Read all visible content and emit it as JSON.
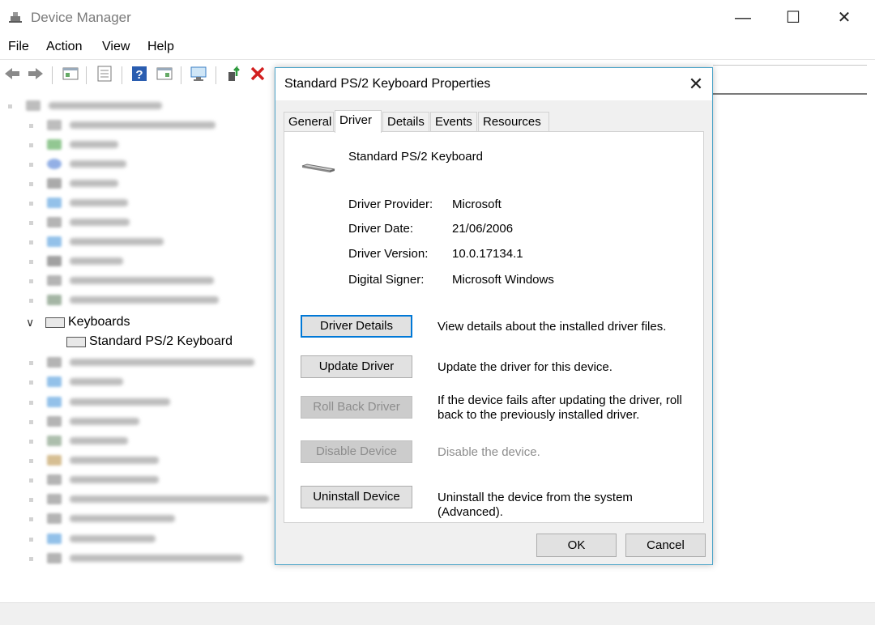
{
  "window": {
    "title": "Device Manager",
    "controls": {
      "minimize": "—",
      "maximize": "☐",
      "close": "✕"
    }
  },
  "menu": [
    "File",
    "Action",
    "View",
    "Help"
  ],
  "tree": {
    "category": "Keyboards",
    "expander": "∨",
    "device": "Standard PS/2 Keyboard"
  },
  "dialog": {
    "title": "Standard PS/2 Keyboard Properties",
    "close": "✕",
    "tabs": [
      "General",
      "Driver",
      "Details",
      "Events",
      "Resources"
    ],
    "active_tab": "Driver",
    "device_name": "Standard PS/2 Keyboard",
    "properties": [
      {
        "label": "Driver Provider:",
        "value": "Microsoft"
      },
      {
        "label": "Driver Date:",
        "value": "21/06/2006"
      },
      {
        "label": "Driver Version:",
        "value": "10.0.17134.1"
      },
      {
        "label": "Digital Signer:",
        "value": "Microsoft Windows"
      }
    ],
    "actions": [
      {
        "label": "Driver Details",
        "description": "View details about the installed driver files.",
        "enabled": true
      },
      {
        "label": "Update Driver",
        "description": "Update the driver for this device.",
        "enabled": true
      },
      {
        "label": "Roll Back Driver",
        "description": "If the device fails after updating the driver, roll back to the previously installed driver.",
        "enabled": false
      },
      {
        "label": "Disable Device",
        "description": "Disable the device.",
        "enabled": false
      },
      {
        "label": "Uninstall Device",
        "description": "Uninstall the device from the system (Advanced).",
        "enabled": true
      }
    ],
    "ok": "OK",
    "cancel": "Cancel"
  },
  "colors": {
    "accent": "#0078d7",
    "dialog_border": "#4aa3c8",
    "disabled_text": "#8d8d8d"
  }
}
